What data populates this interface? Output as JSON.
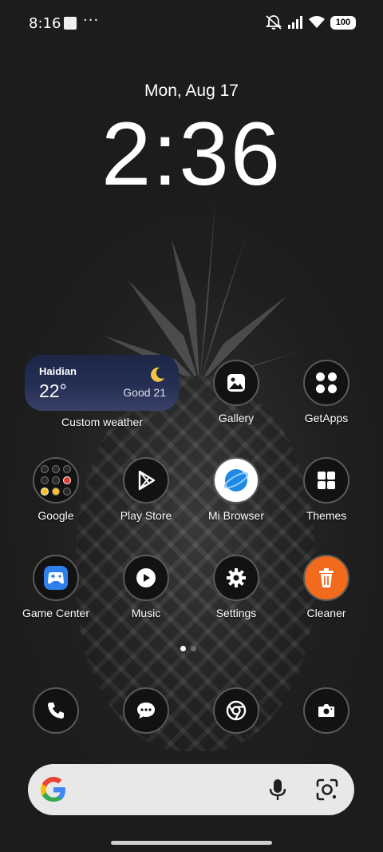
{
  "status_bar": {
    "time": "8:16",
    "more": "···",
    "battery": "100"
  },
  "lock": {
    "date": "Mon, Aug 17",
    "clock": "2:36"
  },
  "weather_widget": {
    "city": "Haidian",
    "temperature": "22°",
    "aqi": "Good 21",
    "label": "Custom weather"
  },
  "apps": {
    "gallery": "Gallery",
    "getapps": "GetApps",
    "google": "Google",
    "play_store": "Play Store",
    "mi_browser": "Mi Browser",
    "themes": "Themes",
    "game_center": "Game Center",
    "music": "Music",
    "settings": "Settings",
    "cleaner": "Cleaner"
  },
  "dock": [
    "phone-icon",
    "messages-icon",
    "chrome-icon",
    "camera-icon"
  ],
  "colors": {
    "cleaner_accent": "#f26a1b",
    "browser_accent": "#1e88e5",
    "game_center_accent": "#2f80ed"
  }
}
